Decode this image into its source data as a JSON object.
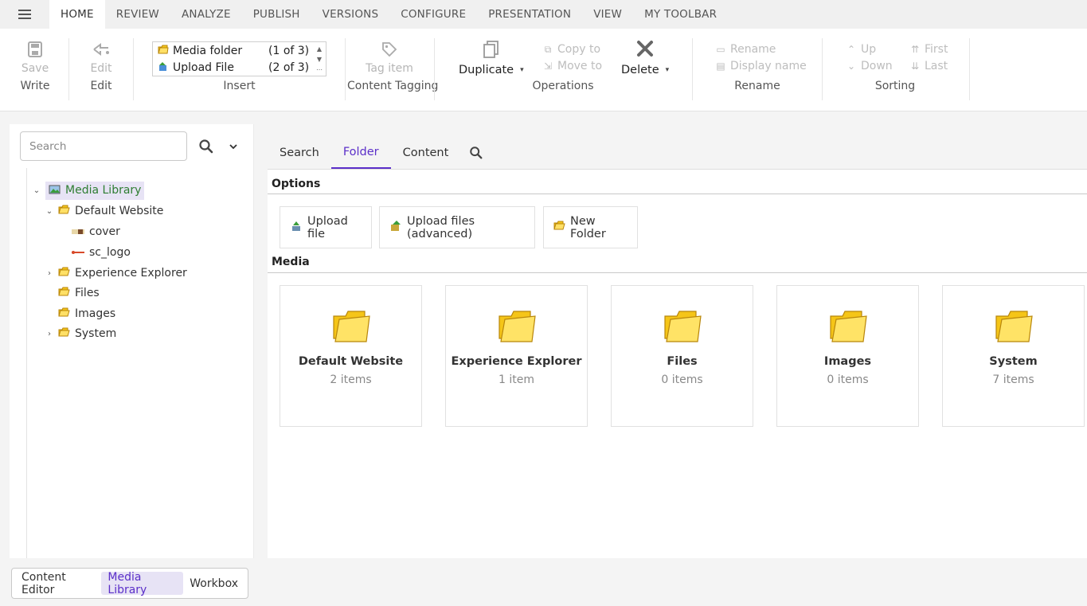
{
  "ribbon_tabs": [
    "HOME",
    "REVIEW",
    "ANALYZE",
    "PUBLISH",
    "VERSIONS",
    "CONFIGURE",
    "PRESENTATION",
    "VIEW",
    "MY TOOLBAR"
  ],
  "ribbon": {
    "write": {
      "button": "Save",
      "group": "Write"
    },
    "edit": {
      "button": "Edit",
      "group": "Edit"
    },
    "insert": {
      "group": "Insert",
      "items": [
        {
          "label": "Media folder",
          "count": "(1 of 3)"
        },
        {
          "label": "Upload File",
          "count": "(2 of 3)"
        }
      ]
    },
    "tagging": {
      "button": "Tag item",
      "group": "Content Tagging"
    },
    "operations": {
      "group": "Operations",
      "duplicate": "Duplicate",
      "copy_to": "Copy to",
      "move_to": "Move to",
      "delete": "Delete"
    },
    "rename": {
      "group": "Rename",
      "rename": "Rename",
      "display_name": "Display name"
    },
    "sorting": {
      "group": "Sorting",
      "up": "Up",
      "down": "Down",
      "first": "First",
      "last": "Last"
    }
  },
  "left_panel": {
    "search_placeholder": "Search",
    "tree": {
      "root": "Media Library",
      "default_website": "Default Website",
      "cover": "cover",
      "sc_logo": "sc_logo",
      "experience_explorer": "Experience Explorer",
      "files": "Files",
      "images": "Images",
      "system": "System"
    }
  },
  "bottom_tabs": [
    "Content Editor",
    "Media Library",
    "Workbox"
  ],
  "content_tabs": [
    "Search",
    "Folder",
    "Content"
  ],
  "content": {
    "options_title": "Options",
    "options": [
      "Upload file",
      "Upload files (advanced)",
      "New Folder"
    ],
    "media_title": "Media",
    "cards": [
      {
        "title": "Default Website",
        "sub": "2 items"
      },
      {
        "title": "Experience Explorer",
        "sub": "1 item"
      },
      {
        "title": "Files",
        "sub": "0 items"
      },
      {
        "title": "Images",
        "sub": "0 items"
      },
      {
        "title": "System",
        "sub": "7 items"
      }
    ]
  },
  "colors": {
    "accent": "#5b2fc9",
    "selected_bg": "#e7e3f5",
    "tree_selected_text": "#2e7d32"
  }
}
